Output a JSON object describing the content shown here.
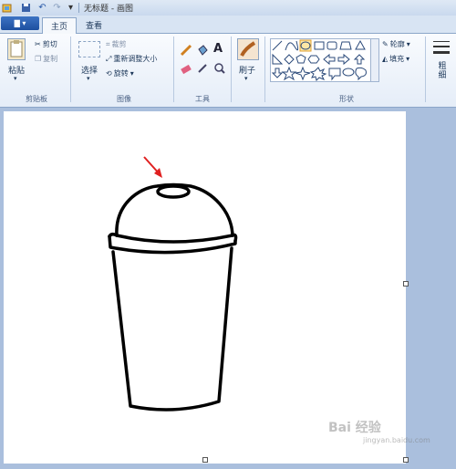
{
  "window": {
    "title": "无标题 - 画图"
  },
  "quick_access": {
    "undo": "↶",
    "redo": "↷",
    "save": "■",
    "dropdown": "▾"
  },
  "app_menu": {
    "label": "▇ ▾"
  },
  "tabs": [
    {
      "label": "主页",
      "active": true
    },
    {
      "label": "查看",
      "active": false
    }
  ],
  "clipboard": {
    "paste": "粘贴",
    "cut": "剪切",
    "copy": "复制",
    "group": "剪贴板"
  },
  "image": {
    "select": "选择",
    "crop": "裁剪",
    "resize": "重新调整大小",
    "rotate": "旋转",
    "group": "图像"
  },
  "tools": {
    "group": "工具",
    "text_glyph": "A"
  },
  "brushes": {
    "label": "刷子"
  },
  "shapes": {
    "outline": "轮廓",
    "fill": "填充",
    "group": "形状"
  },
  "size": {
    "label": "粗\n细"
  },
  "watermark": {
    "text": "Bai 经验",
    "sub": "jingyan.baidu.com"
  },
  "colors": {
    "accent": "#1d4f9f",
    "arrow": "#e02020"
  }
}
